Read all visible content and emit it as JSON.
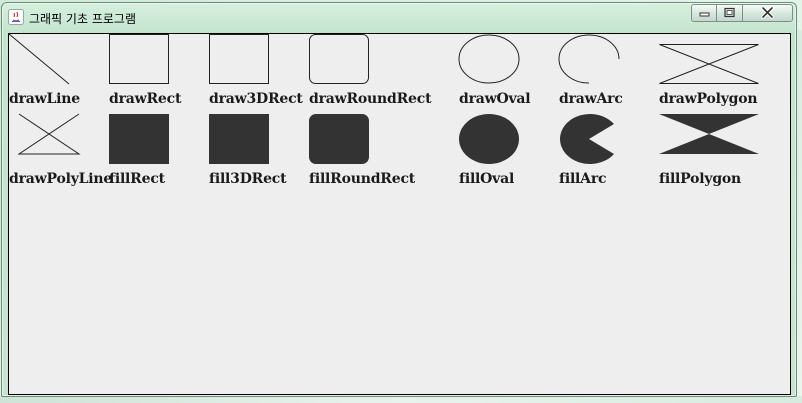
{
  "window": {
    "title": "그래픽 기초 프로그램",
    "controls": [
      "minimize",
      "maximize",
      "close"
    ]
  },
  "canvas": {
    "background": "#eeeeee",
    "fill_color": "#333333",
    "stroke_color": "#222222",
    "row1_labels": [
      "drawLine",
      "drawRect",
      "draw3DRect",
      "drawRoundRect",
      "drawOval",
      "drawArc",
      "drawPolygon"
    ],
    "row2_labels": [
      "drawPolyLine",
      "fillRect",
      "fill3DRect",
      "fillRoundRect",
      "fillOval",
      "fillArc",
      "fillPolygon"
    ]
  }
}
